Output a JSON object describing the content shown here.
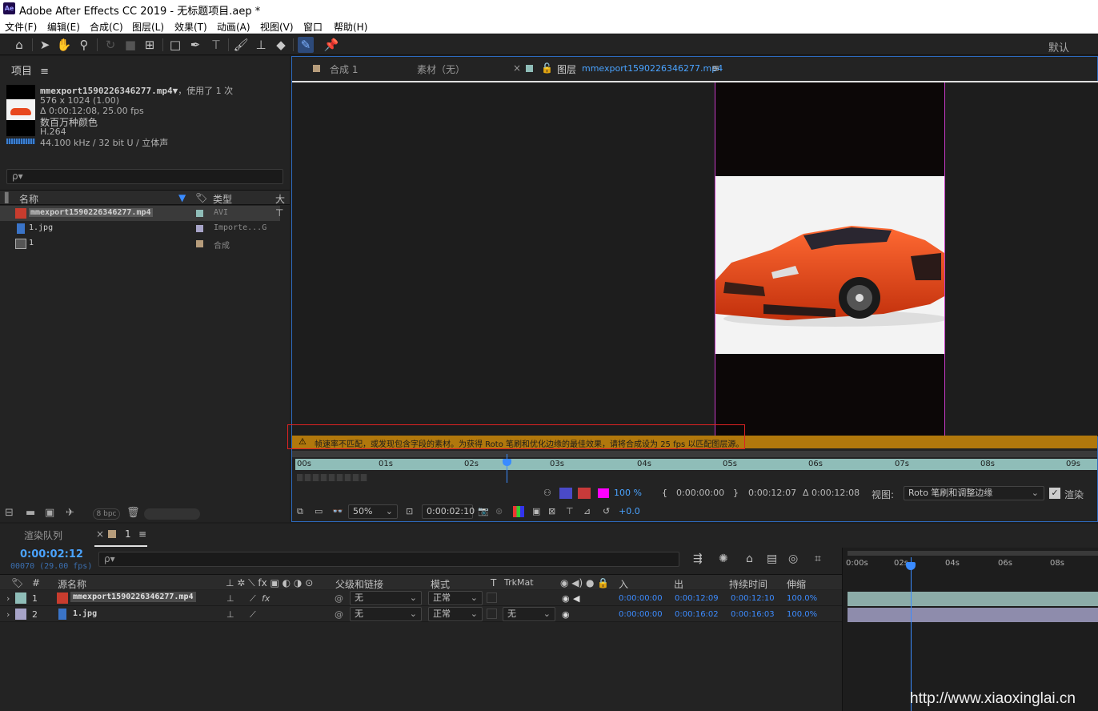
{
  "window": {
    "logo": "Ae",
    "title": "Adobe After Effects CC 2019 - 无标题项目.aep *"
  },
  "menu": [
    "文件(F)",
    "编辑(E)",
    "合成(C)",
    "图层(L)",
    "效果(T)",
    "动画(A)",
    "视图(V)",
    "窗口",
    "帮助(H)"
  ],
  "toolbar": {
    "icons": [
      "home-icon",
      "selection-arrow-icon",
      "hand-icon",
      "zoom-icon",
      "rotate-icon",
      "camera-icon",
      "pan-behind-icon",
      "rectangle-icon",
      "pen-icon",
      "type-icon",
      "brush-icon",
      "clone-stamp-icon",
      "eraser-icon",
      "roto-brush-icon",
      "puppet-pin-icon"
    ],
    "workspace": "默认"
  },
  "project": {
    "tab": "项目",
    "file_name": "mmexport1590226346277.mp4▼",
    "used": "，使用了 1 次",
    "dims": "576 x 1024 (1.00)",
    "duration": "Δ 0:00:12:08, 25.00 fps",
    "colors": "数百万种颜色",
    "codec": "H.264",
    "audio": "44.100 kHz / 32 bit U / 立体声",
    "search_placeholder": "ρ▾",
    "columns": {
      "name": "名称",
      "type": "类型",
      "size": "大"
    },
    "items": [
      {
        "name": "mmexport1590226346277.mp4",
        "type": "AVI"
      },
      {
        "name": "1.jpg",
        "type": "Importe...G"
      },
      {
        "name": "1",
        "type": "合成"
      }
    ],
    "bpc": "8 bpc"
  },
  "viewer": {
    "tabs": {
      "comp": "合成 1",
      "footage": "素材（无）",
      "layer_prefix": "图层",
      "layer_name": "mmexport1590226346277.mp4"
    },
    "warning": "帧速率不匹配，或发现包含字段的素材。为获得 Roto 笔刷和优化边缘的最佳效果，请将合成设为 25 fps 以匹配图层源。",
    "ruler_ticks": [
      "00s",
      "01s",
      "02s",
      "03s",
      "04s",
      "05s",
      "06s",
      "07s",
      "08s",
      "09s"
    ],
    "zoom_percent": "100 %",
    "in_time": "0:00:00:00",
    "out_time": "0:00:12:07",
    "duration": "Δ 0:00:12:08",
    "view_label": "视图:",
    "view_value": "Roto 笔刷和调整边缘",
    "render_label": "渲染",
    "magnification": "50%",
    "current_time": "0:00:02:10",
    "exposure": "+0.0"
  },
  "timeline": {
    "render_queue": "渲染队列",
    "comp_tab": "1",
    "current_time": "0:00:02:12",
    "fps": "00070 (29.00 fps)",
    "search_placeholder": "ρ▾",
    "headers": {
      "num": "#",
      "src": "源名称",
      "parent": "父级和链接",
      "mode": "模式",
      "t": "T",
      "trkmat": "TrkMat",
      "in": "入",
      "out": "出",
      "dur": "持续时间",
      "stretch": "伸缩"
    },
    "layers": [
      {
        "num": "1",
        "name": "mmexport1590226346277.mp4",
        "parent": "无",
        "mode": "正常",
        "trkmat": "",
        "in": "0:00:00:00",
        "out": "0:00:12:09",
        "dur": "0:00:12:10",
        "stretch": "100.0%",
        "color": "#8fbdb8"
      },
      {
        "num": "2",
        "name": "1.jpg",
        "parent": "无",
        "mode": "正常",
        "trkmat": "无",
        "in": "0:00:00:00",
        "out": "0:00:16:02",
        "dur": "0:00:16:03",
        "stretch": "100.0%",
        "color": "#a7a4c8"
      }
    ],
    "ruler_ticks": [
      "0:00s",
      "02s",
      "04s",
      "06s",
      "08s"
    ]
  },
  "watermark": "http://www.xiaoxinglai.cn"
}
